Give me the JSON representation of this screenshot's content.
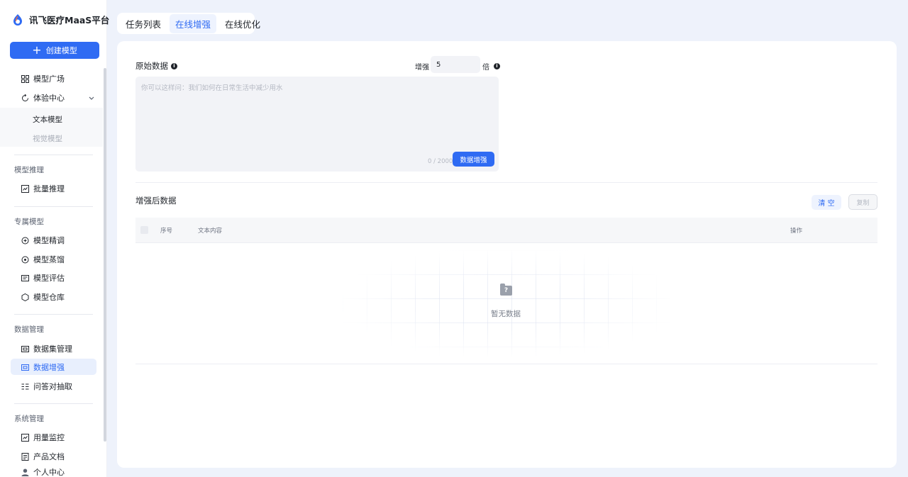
{
  "app": {
    "title": "讯飞医疗MaaS平台",
    "create_button": "创建模型"
  },
  "sidebar": {
    "model_square": "模型广场",
    "experience_center": "体验中心",
    "text_model": "文本模型",
    "vision_model": "视觉模型",
    "sections": {
      "inference": "模型推理",
      "exclusive": "专属模型",
      "data_mgmt": "数据管理",
      "system": "系统管理"
    },
    "batch_inference": "批量推理",
    "fine_tune": "模型精调",
    "distill": "模型蒸馏",
    "evaluate": "模型评估",
    "warehouse": "模型仓库",
    "dataset_mgmt": "数据集管理",
    "data_enhance": "数据增强",
    "qa_extract": "问答对抽取",
    "usage_monitor": "用量监控",
    "product_docs": "产品文档",
    "personal_center": "个人中心"
  },
  "tabs": [
    "任务列表",
    "在线增强",
    "在线优化"
  ],
  "active_tab": 1,
  "form": {
    "raw_data_label": "原始数据",
    "enhance_label": "增强",
    "times_value": "5",
    "times_unit": "倍",
    "textarea_placeholder": "你可以这样问：我们如何在日常生活中减少用水",
    "char_count": "0 / 2000",
    "enhance_button": "数据增强"
  },
  "result": {
    "title": "增强后数据",
    "clear_button": "清 空",
    "copy_button": "复制",
    "columns": {
      "index": "序号",
      "content": "文本内容",
      "action": "操作"
    },
    "empty_text": "暂无数据"
  },
  "colors": {
    "primary": "#2f6bf3",
    "page_bg": "#eef2fb",
    "active_bg": "#e8effd"
  }
}
